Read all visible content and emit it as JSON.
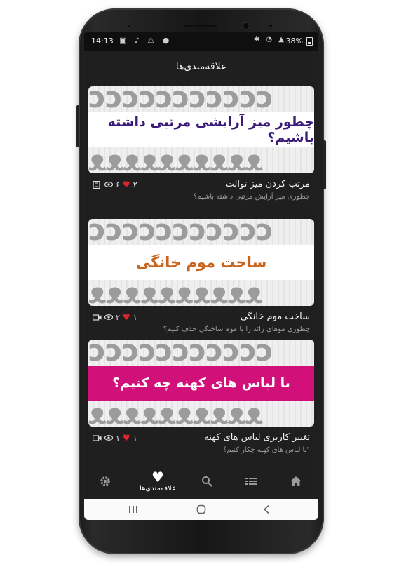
{
  "status_bar": {
    "time": "14:13",
    "battery": "38%",
    "network": "4G"
  },
  "app_bar": {
    "title": "علاقه‌مندی‌ها"
  },
  "cards": [
    {
      "banner_text": "چطور میز آرایشی مرتبی داشته باشیم؟",
      "banner_color": "#3b1a7a",
      "strip_bg": "#ffffff",
      "title": "مرتب کردن میز توالت",
      "subtitle": "چطوری میز آرایش مرتبی داشته باشیم؟",
      "likes": "۲",
      "views": "۶",
      "type_icon": "document-icon"
    },
    {
      "banner_text": "ساخت موم خانگی",
      "banner_color": "#c8641e",
      "strip_bg": "#ffffff",
      "title": "ساخت موم خانگی",
      "subtitle": "چطوری موهای زائد را با موم ساختگی حذف کنیم؟",
      "likes": "۱",
      "views": "۲",
      "type_icon": "video-icon"
    },
    {
      "banner_text": "با لباس های کهنه چه کنیم؟",
      "banner_color": "#ffffff",
      "strip_bg": "#d1107a",
      "title": "تغییر کاربری لباس های کهنه",
      "subtitle": "\"با لباس های کهنه چکار کنیم؟",
      "likes": "۱",
      "views": "۱",
      "type_icon": "video-icon"
    }
  ],
  "bottom_nav": {
    "active_label": "علاقه‌مندی‌ها",
    "items": [
      "settings-icon",
      "heart-icon",
      "search-icon",
      "list-icon",
      "home-icon"
    ]
  },
  "colors": {
    "background": "#1f1f1f",
    "heart": "#e0242c",
    "pattern": "#9c9c9c"
  }
}
